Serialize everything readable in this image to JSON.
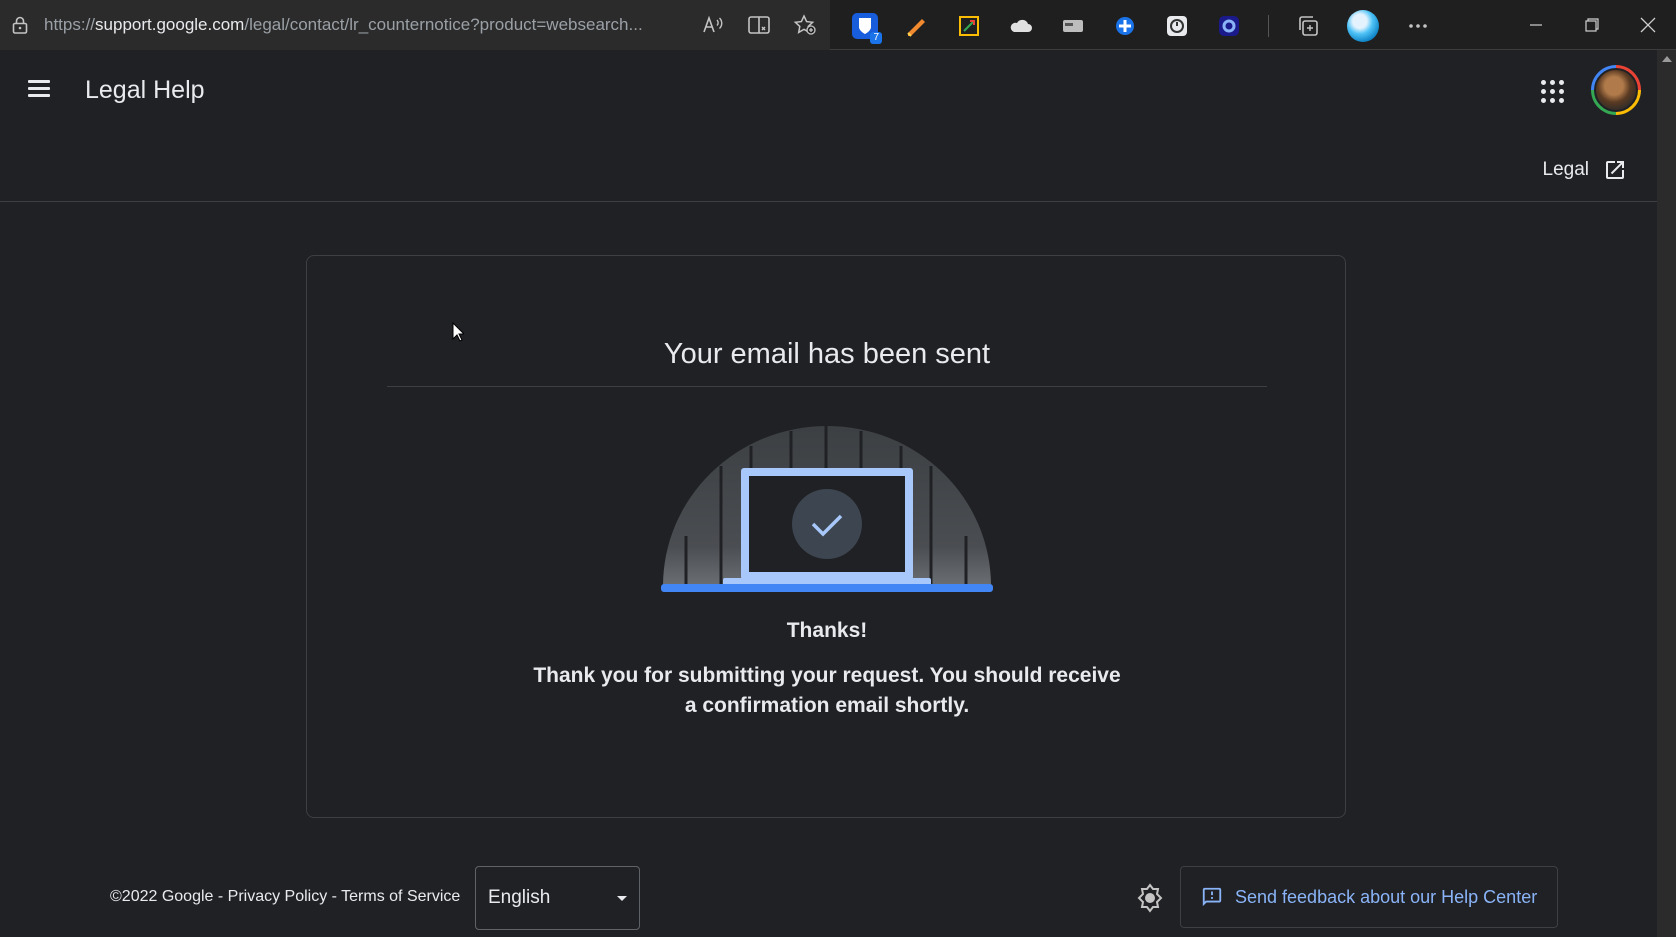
{
  "browser": {
    "url_prefix": "https://",
    "url_host": "support.google.com",
    "url_path": "/legal/contact/lr_counternotice?product=websearch...",
    "extension_badge": "7"
  },
  "header": {
    "title": "Legal Help"
  },
  "subheader": {
    "legal_link": "Legal"
  },
  "card": {
    "title": "Your email has been sent",
    "thanks": "Thanks!",
    "message": "Thank you for submitting your request. You should receive a confirmation email shortly."
  },
  "footer": {
    "copyright": "©2022 Google",
    "dash1": " - ",
    "privacy": "Privacy Policy",
    "dash2": " - ",
    "terms": "Terms of Service",
    "language": "English",
    "feedback": "Send feedback about our Help Center"
  },
  "colors": {
    "background": "#202124",
    "link_blue": "#8ab4f8",
    "illustration_blue": "#4285f4"
  }
}
